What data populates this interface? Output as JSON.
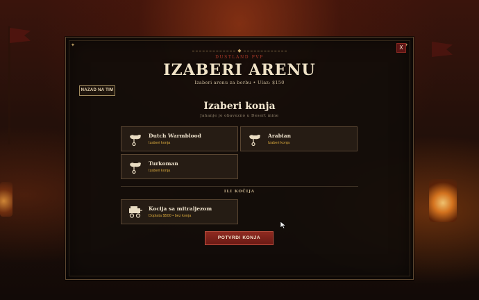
{
  "modal": {
    "close_label": "X",
    "eyebrow": "DUSTLAND PVP",
    "title": "IZABERI ARENU",
    "subtitle": "Izaberi arenu za borbu • Ulaz: $150",
    "back_label": "NAZAD NA TIM"
  },
  "horse_section": {
    "title": "Izaberi konja",
    "subtitle": "Jahanje je obavezno u Desert mine",
    "horses": [
      {
        "name": "Dutch Warmblood",
        "action": "Izaberi konja",
        "icon": "horse-saddle-icon"
      },
      {
        "name": "Arabian",
        "action": "Izaberi konja",
        "icon": "horse-saddle-icon"
      },
      {
        "name": "Turkoman",
        "action": "Izaberi konja",
        "icon": "horse-saddle-icon"
      }
    ]
  },
  "carriage_section": {
    "divider_label": "ILI KOČIJA",
    "carriage": {
      "name": "Kocija sa mitraljezom",
      "detail": "Doplata $500 • bez konja",
      "icon": "wagon-icon"
    }
  },
  "confirm_label": "POTVRDI KONJA",
  "colors": {
    "accent_red": "#8e2a20",
    "gold": "#d8a83c",
    "panel_bg": "#120d0a",
    "border": "#5c4730"
  }
}
